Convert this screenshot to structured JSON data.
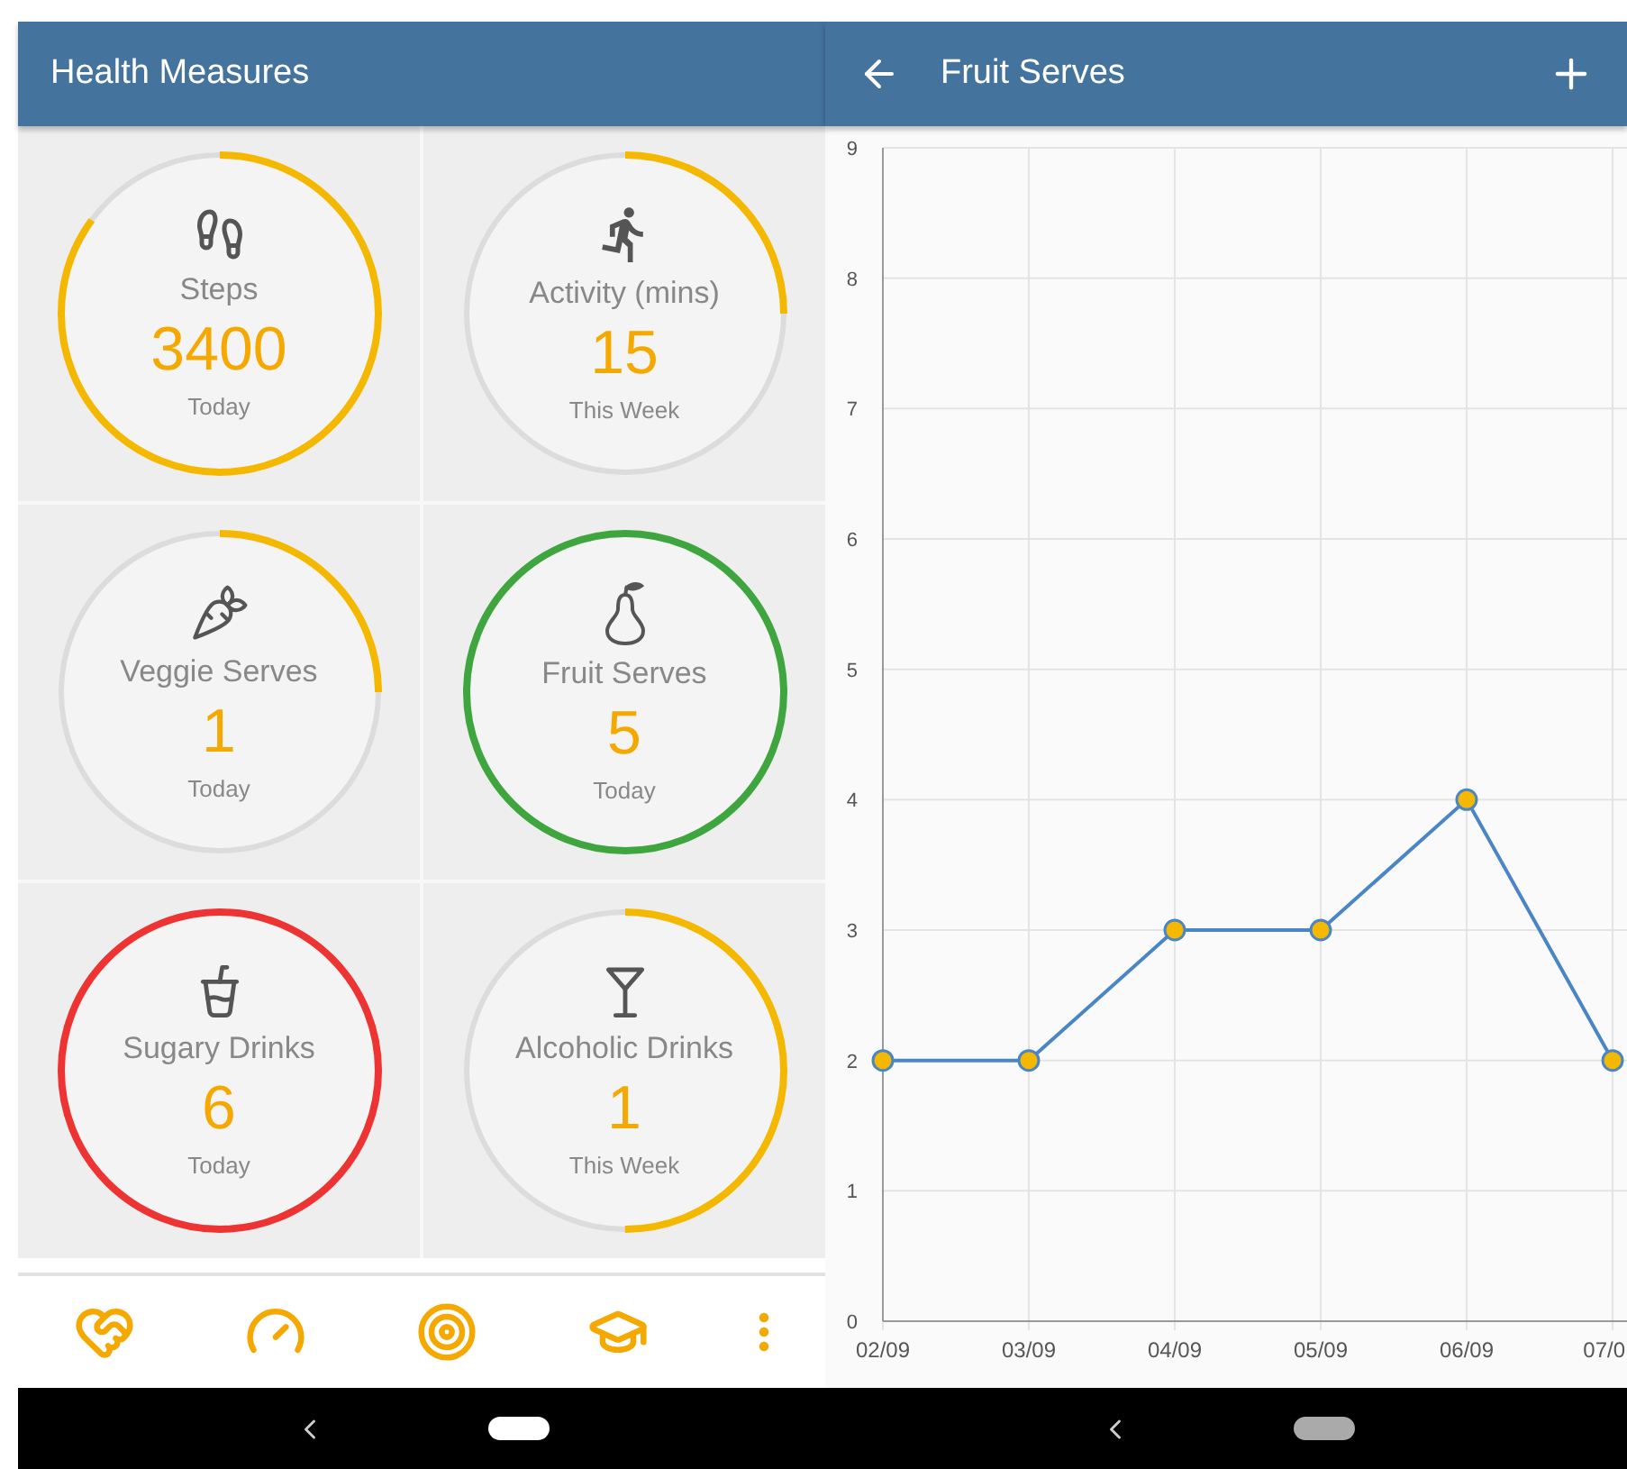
{
  "left": {
    "title": "Health Measures",
    "tiles": [
      {
        "label": "Steps",
        "value": "3400",
        "period": "Today",
        "level": 0.85,
        "color": "#f5b800"
      },
      {
        "label": "Activity (mins)",
        "value": "15",
        "period": "This Week",
        "level": 0.25,
        "color": "#f5b800"
      },
      {
        "label": "Veggie Serves",
        "value": "1",
        "period": "Today",
        "level": 0.25,
        "color": "#f5b800"
      },
      {
        "label": "Fruit Serves",
        "value": "5",
        "period": "Today",
        "level": 1,
        "color": "#3fa63f"
      },
      {
        "label": "Sugary Drinks",
        "value": "6",
        "period": "Today",
        "level": 1,
        "color": "#ee3333"
      },
      {
        "label": "Alcoholic Drinks",
        "value": "1",
        "period": "This Week",
        "level": 0.5,
        "color": "#f5b800"
      }
    ]
  },
  "right": {
    "title": "Fruit Serves",
    "chart_data": {
      "type": "line",
      "categories": [
        "02/09",
        "03/09",
        "04/09",
        "05/09",
        "06/09",
        "07/0"
      ],
      "series": [
        {
          "color": "#4a86c5",
          "marker": "circle",
          "values": [
            2,
            2,
            3,
            3,
            4,
            2
          ]
        }
      ],
      "grid": true,
      "ylim": [
        0,
        9
      ],
      "yticks": [
        0,
        1,
        2,
        3,
        4,
        5,
        6,
        7,
        8,
        9
      ]
    }
  }
}
